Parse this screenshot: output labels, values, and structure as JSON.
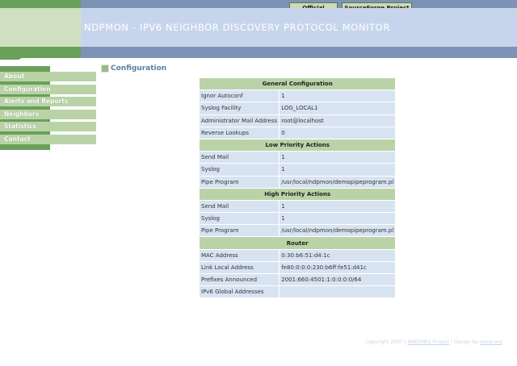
{
  "top_links": [
    "Official Website",
    "SourceForge Project Page"
  ],
  "header": {
    "title": "NDPMON - IPV6 NEIGHBOR DISCOVERY PROTOCOL MONITOR"
  },
  "nav": [
    "About",
    "Configuration",
    "Alerts and Reports",
    "Neighbors",
    "Statistics",
    "Contact"
  ],
  "page": {
    "heading": "Configuration"
  },
  "sections": {
    "general": {
      "title": "General Configuration",
      "rows": [
        [
          "Ignor Autoconf",
          "1"
        ],
        [
          "Syslog Facility",
          "LOG_LOCAL1"
        ],
        [
          "Administrator Mail Address",
          "root@localhost"
        ],
        [
          "Reverse Lookups",
          "0"
        ]
      ]
    },
    "low": {
      "title": "Low Priority Actions",
      "rows": [
        [
          "Send Mail",
          "1"
        ],
        [
          "Syslog",
          "1"
        ],
        [
          "Pipe Program",
          "/usr/local/ndpmon/demopipeprogram.pl"
        ]
      ]
    },
    "high": {
      "title": "High Priority Actions",
      "rows": [
        [
          "Send Mail",
          "1"
        ],
        [
          "Syslog",
          "1"
        ],
        [
          "Pipe Program",
          "/usr/local/ndpmon/demopipeprogram.pl"
        ]
      ]
    },
    "router": {
      "title": "Router",
      "rows": [
        [
          "MAC Address",
          "0:30:b6:51:d4:1c"
        ],
        [
          "Link Local Address",
          "fe80:0:0:0:230:b6ff:fe51:d41c"
        ],
        [
          "Prefixes Announced",
          "2001:660:4501:1:0:0:0:0/64"
        ],
        [
          "IPv6 Global Addresses",
          ""
        ]
      ]
    }
  },
  "footer": {
    "copyright": "Copyright 2007 |",
    "project": "MADYNES Project",
    "separator": "|",
    "design": "Design by",
    "designer": "oswd.org"
  },
  "colors": {
    "green": "#6aa05a",
    "light_green": "#b9d3a6",
    "blue": "#7d93b5",
    "light_blue": "#d8e3f2"
  }
}
